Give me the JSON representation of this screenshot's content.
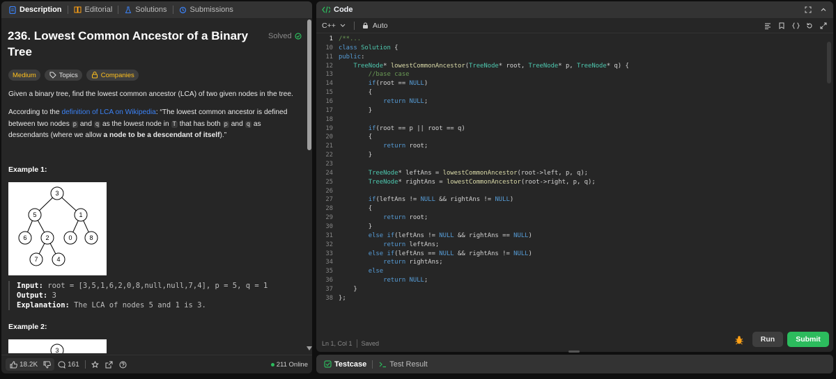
{
  "left_tabs": [
    {
      "label": "Description",
      "icon": "document-icon"
    },
    {
      "label": "Editorial",
      "icon": "book-icon"
    },
    {
      "label": "Solutions",
      "icon": "flask-icon"
    },
    {
      "label": "Submissions",
      "icon": "history-icon"
    }
  ],
  "problem": {
    "title": "236. Lowest Common Ancestor of a Binary Tree",
    "status": "Solved",
    "difficulty": "Medium",
    "topics_label": "Topics",
    "companies_label": "Companies",
    "intro": "Given a binary tree, find the lowest common ancestor (LCA) of two given nodes in the tree.",
    "def_prefix": "According to the ",
    "def_link": "definition of LCA on Wikipedia",
    "def_rest1": ": “The lowest common ancestor is defined between two nodes ",
    "code_p": "p",
    "def_and": " and ",
    "code_q": "q",
    "def_rest2": " as the lowest node in ",
    "code_T": "T",
    "def_rest3": " that has both ",
    "def_rest4": " as descendants (where we allow ",
    "def_bold": "a node to be a descendant of itself",
    "def_end": ").”",
    "example1_heading": "Example 1:",
    "example1_input_label": "Input:",
    "example1_input": " root = [3,5,1,6,2,0,8,null,null,7,4], p = 5, q = 1",
    "example1_output_label": "Output:",
    "example1_output": " 3",
    "example1_expl_label": "Explanation:",
    "example1_expl": " The LCA of nodes 5 and 1 is 3.",
    "example2_heading": "Example 2:",
    "tree1_nodes": [
      "3",
      "5",
      "1",
      "6",
      "2",
      "0",
      "8",
      "7",
      "4"
    ],
    "tree2_root": "3"
  },
  "left_footer": {
    "likes": "18.2K",
    "comments": "161",
    "online": "211 Online"
  },
  "code_panel": {
    "title": "Code",
    "language": "C++",
    "mode": "Auto",
    "status_position": "Ln 1, Col 1",
    "status_saved": "Saved",
    "run_label": "Run",
    "submit_label": "Submit"
  },
  "code_lines": [
    {
      "n": "1",
      "t": "/**..."
    },
    {
      "n": "10",
      "t": "class Solution {"
    },
    {
      "n": "11",
      "t": "public:"
    },
    {
      "n": "12",
      "t": "    TreeNode* lowestCommonAncestor(TreeNode* root, TreeNode* p, TreeNode* q) {"
    },
    {
      "n": "13",
      "t": "        //base case"
    },
    {
      "n": "14",
      "t": "        if(root == NULL)"
    },
    {
      "n": "15",
      "t": "        {"
    },
    {
      "n": "16",
      "t": "            return NULL;"
    },
    {
      "n": "17",
      "t": "        }"
    },
    {
      "n": "18",
      "t": ""
    },
    {
      "n": "19",
      "t": "        if(root == p || root == q)"
    },
    {
      "n": "20",
      "t": "        {"
    },
    {
      "n": "21",
      "t": "            return root;"
    },
    {
      "n": "22",
      "t": "        }"
    },
    {
      "n": "23",
      "t": ""
    },
    {
      "n": "24",
      "t": "        TreeNode* leftAns = lowestCommonAncestor(root->left, p, q);"
    },
    {
      "n": "25",
      "t": "        TreeNode* rightAns = lowestCommonAncestor(root->right, p, q);"
    },
    {
      "n": "26",
      "t": ""
    },
    {
      "n": "27",
      "t": "        if(leftAns != NULL && rightAns != NULL)"
    },
    {
      "n": "28",
      "t": "        {"
    },
    {
      "n": "29",
      "t": "            return root;"
    },
    {
      "n": "30",
      "t": "        }"
    },
    {
      "n": "31",
      "t": "        else if(leftAns != NULL && rightAns == NULL)"
    },
    {
      "n": "32",
      "t": "            return leftAns;"
    },
    {
      "n": "33",
      "t": "        else if(leftAns == NULL && rightAns != NULL)"
    },
    {
      "n": "34",
      "t": "            return rightAns;"
    },
    {
      "n": "35",
      "t": "        else"
    },
    {
      "n": "36",
      "t": "            return NULL;"
    },
    {
      "n": "37",
      "t": "    }"
    },
    {
      "n": "38",
      "t": "};"
    }
  ],
  "test_tabs": [
    {
      "label": "Testcase"
    },
    {
      "label": "Test Result"
    }
  ],
  "colors": {
    "accent_green": "#2cbb5d",
    "medium": "#ffc01e",
    "link": "#3b82f6"
  }
}
